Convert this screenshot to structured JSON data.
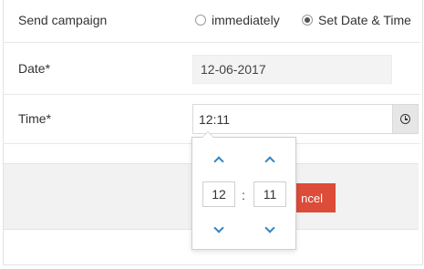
{
  "form": {
    "send_campaign_label": "Send campaign",
    "radio_immediately": "immediately",
    "radio_set_date_time": "Set Date & Time",
    "date_label": "Date*",
    "date_value": "12-06-2017",
    "time_label": "Time*",
    "time_value": "12:11"
  },
  "picker": {
    "hour": "12",
    "minute": "11",
    "separator": ":"
  },
  "footer": {
    "cancel_label_visible": "ncel"
  },
  "icons": {
    "time_addon": "clock-icon",
    "increment": "chevron-up-icon",
    "decrement": "chevron-down-icon"
  },
  "colors": {
    "accent_blue": "#2f86c3",
    "cancel_red": "#dd4b39"
  }
}
